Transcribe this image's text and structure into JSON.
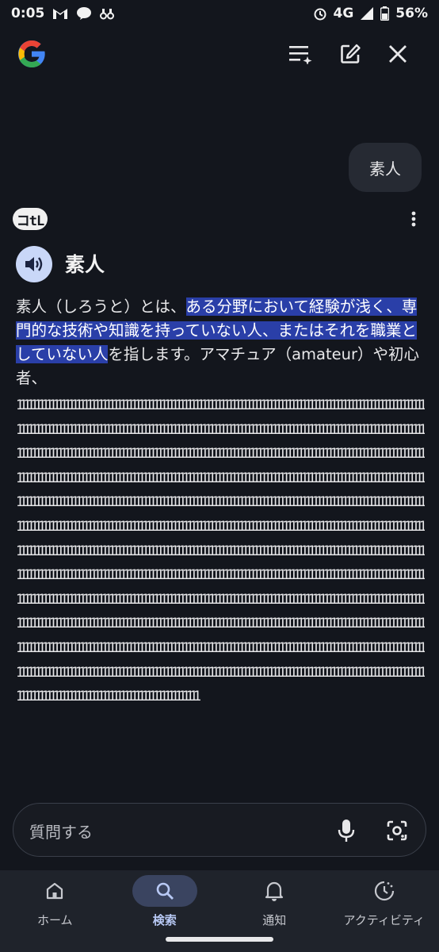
{
  "status": {
    "time": "0:05",
    "network": "4G",
    "battery": "56%"
  },
  "query": "素人",
  "source_logo_text": "コtL",
  "result": {
    "word": "素人",
    "definition_pre": "素人（しろうと）とは、",
    "definition_highlight": "ある分野において経験が浅く、専門的な技術や知識を持っていない人、またはそれを職業としていない人",
    "definition_post": "を指します。アマチュア（amateur）や初心者、",
    "ones_text": "1111111111111111111111111111111111111111111111111111111111111111111111111111111111111111111111111111111111111111111111111111111111111111111111111111111111111111111111111111111111111111111111111111111111111111111111111111111111111111111111111111111111111111111111111111111111111111111111111111111111111111111111111111111111111111111111111111111111111111111111111111111111111111111111111111111111111111111111111111111111111111111111111111111111111111111111111111111111111111111111111111111111111111111111111111111111111111111111111111111111111111111111111111111111111111111111111111111111111111111111111111111111111111111111111111111111111111111111111111111111111111111111111111111111111111111111111111111111111111111111111111111111111111111111111111111111111111111111111111111111111111111111111111111111111111111111111111111111111111111111111111111111111111111111111111111111111111111111111111111111111111111111111111111111111111111111111111111111111111111111111111111111111111111111111111111111111111111111111111111111111111111111111111111111111111111111111111111111111111111111111111111111111111111111111111111111111111111111111111111111111111111111111111111111111111111111111111111111111111111111111111111111111111111111111111111111111111111111111111111111111111111111111111111111111111111111111111111111111111111111111111111111111111111111111111111111111111111111111"
  },
  "ask": {
    "placeholder": "質問する"
  },
  "nav": [
    {
      "label": "ホーム",
      "icon": "home-icon",
      "active": false
    },
    {
      "label": "検索",
      "icon": "search-icon",
      "active": true
    },
    {
      "label": "通知",
      "icon": "bell-icon",
      "active": false
    },
    {
      "label": "アクティビティ",
      "icon": "activity-icon",
      "active": false
    }
  ],
  "colors": {
    "accent": "#2a3fa8",
    "background": "#13161d",
    "speaker": "#c9d7f8"
  }
}
